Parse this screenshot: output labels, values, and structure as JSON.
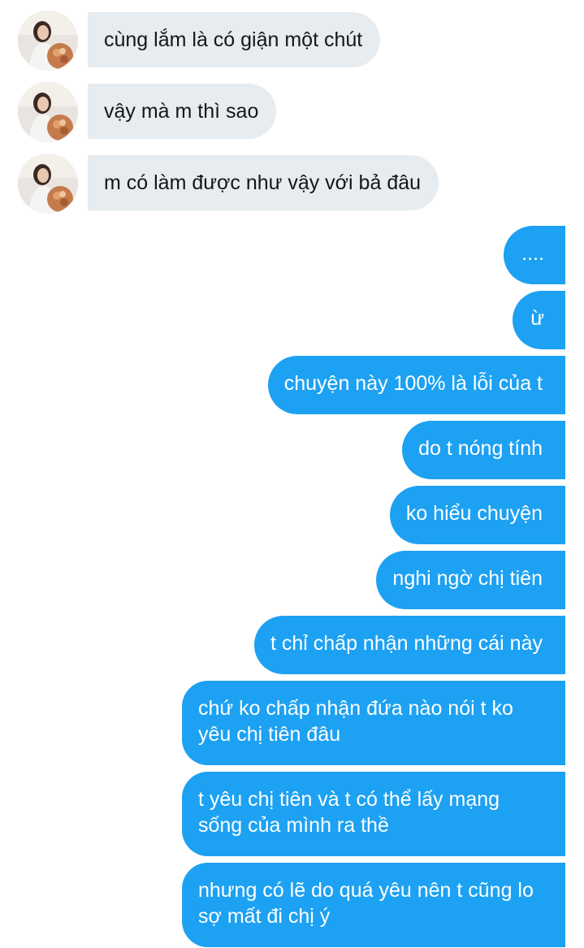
{
  "incoming": [
    {
      "text": "cùng lắm là có giận một chút",
      "avatar": "profile-photo"
    },
    {
      "text": "vậy mà m thì sao",
      "avatar": "profile-photo"
    },
    {
      "text": "m có làm được như vậy với bả đâu",
      "avatar": "profile-photo"
    }
  ],
  "outgoing": [
    {
      "text": "...."
    },
    {
      "text": "ừ"
    },
    {
      "text": "chuyện này 100% là lỗi của t"
    },
    {
      "text": "do t nóng tính"
    },
    {
      "text": "ko hiểu chuyện"
    },
    {
      "text": "nghi ngờ chị tiên"
    },
    {
      "text": "t chỉ chấp nhận những cái này"
    },
    {
      "text": "chứ ko chấp nhận đứa nào nói t ko yêu chị tiên đâu"
    },
    {
      "text": "t yêu chị tiên và t có thể lấy mạng sống của mình ra thề"
    },
    {
      "text": "nhưng có lẽ do quá yêu nên t cũng lo sợ mất đi chị ý"
    }
  ],
  "colors": {
    "incoming_bubble": "#e6ecf0",
    "outgoing_bubble": "#1da1f2",
    "incoming_text": "#14171a",
    "outgoing_text": "#ffffff"
  }
}
